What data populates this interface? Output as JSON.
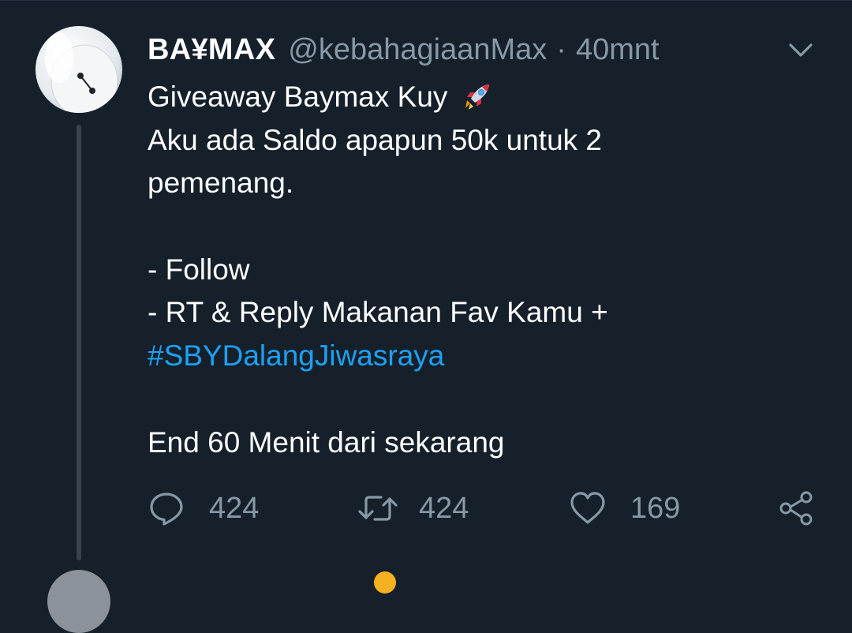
{
  "tweet": {
    "display_name": "BA¥MAX",
    "handle": "@kebahagiaanMax",
    "separator": "·",
    "time": "40mnt",
    "lines": [
      "Giveaway Baymax Kuy",
      "Aku ada Saldo apapun 50k untuk 2",
      "pemenang.",
      "- Follow",
      "- RT & Reply Makanan Fav Kamu +",
      "#SBYDalangJiwasraya",
      "End 60 Menit dari sekarang"
    ],
    "emoji": "rocket-emoji"
  },
  "actions": {
    "reply_count": "424",
    "retweet_count": "424",
    "like_count": "169"
  },
  "icons": {
    "reply": "reply-icon",
    "retweet": "retweet-icon",
    "like": "heart-icon",
    "share": "share-icon",
    "menu": "chevron-down-icon"
  },
  "colors": {
    "background": "#15202b",
    "text": "#ffffff",
    "secondary_text": "#8899a6",
    "link": "#1da1f2",
    "thread_line": "#38444d"
  }
}
